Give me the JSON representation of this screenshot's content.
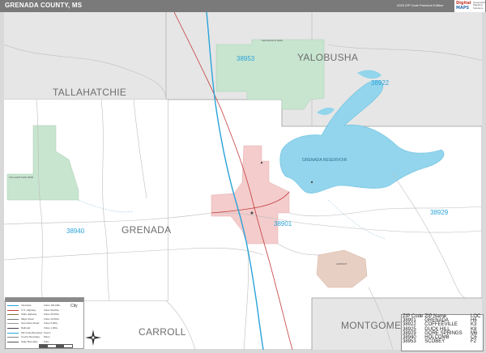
{
  "header": {
    "title": "GRENADA COUNTY, MS",
    "edition": "2023 ZIP Code Premium Edition"
  },
  "logo": {
    "brand_top": "Digital",
    "brand_bottom": "MAPS",
    "tagline": "Geographic Mapping Solutions"
  },
  "counties": {
    "tallahatchie": "TALLAHATCHIE",
    "yalobusha": "YALOBUSHA",
    "grenada": "GRENADA",
    "carroll": "CARROLL",
    "montgomery": "MONTGOMER"
  },
  "zip_labels": {
    "z38953": "38953",
    "z38922": "38922",
    "z38901": "38901",
    "z38929": "38929",
    "z38940": "38940"
  },
  "places": {
    "lake": "GRENADA RESERVOIR",
    "wma_west": "TALLAHATCHIE NWR",
    "wma_north": "MALMAISON WMA",
    "airport": "AIRPORT"
  },
  "legend": {
    "city": "City",
    "rows": [
      {
        "label": "Interstate",
        "value": "Cities 100,000+",
        "color": "#2aa3d9"
      },
      {
        "label": "U.S. Highway",
        "value": "Cities 50,000+",
        "color": "#c43b3b"
      },
      {
        "label": "State Highway",
        "value": "Cities 25,000+",
        "color": "#8a6d3b"
      },
      {
        "label": "Major Road",
        "value": "Cities 10,000+",
        "color": "#777777"
      },
      {
        "label": "Secondary Road",
        "value": "Cities 5,000+",
        "color": "#999999"
      },
      {
        "label": "Railroad",
        "value": "Cities 1,000+",
        "color": "#444444"
      },
      {
        "label": "ZIP Code Boundary",
        "value": "Towns",
        "color": "#2aa3d9"
      },
      {
        "label": "County Boundary",
        "value": "Place",
        "color": "#888888"
      },
      {
        "label": "State Boundary",
        "value": "Park",
        "color": "#555555"
      }
    ]
  },
  "zip_table": {
    "headers": [
      "ZIP Code",
      "ZIP Name",
      "LOC"
    ],
    "rows": [
      [
        "38901",
        "GRENADA",
        "H6"
      ],
      [
        "38922",
        "COFFEEVILLE",
        "K3"
      ],
      [
        "38925",
        "DUCK HILL",
        "K8"
      ],
      [
        "38929",
        "GORE SPRINGS",
        "M6"
      ],
      [
        "38940",
        "HOLCOMB",
        "C6"
      ],
      [
        "38953",
        "SCOBEY",
        "F2"
      ]
    ]
  },
  "colors": {
    "county_fill": "#ffffff",
    "outside_fill": "#d9d9d9",
    "park_green": "#c7e5cf",
    "city_pink": "#f4cccc",
    "lake_blue": "#92d5ec",
    "interstate": "#2aa3d9",
    "highway": "#c43b3b",
    "zip_text": "#2aa3d9"
  }
}
